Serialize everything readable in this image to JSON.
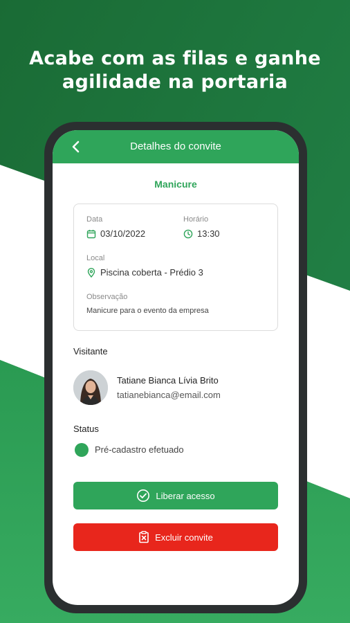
{
  "headline": {
    "line1": "Acabe com as filas e ganhe",
    "line2": "agilidade na portaria"
  },
  "appbar": {
    "title": "Detalhes do convite",
    "back_icon": "chevron-left-icon"
  },
  "invite": {
    "title": "Manicure",
    "date_label": "Data",
    "date_value": "03/10/2022",
    "time_label": "Horário",
    "time_value": "13:30",
    "location_label": "Local",
    "location_value": "Piscina coberta - Prédio 3",
    "note_label": "Observação",
    "note_value": "Manicure para o evento da empresa"
  },
  "visitor": {
    "section_label": "Visitante",
    "name": "Tatiane Bianca Lívia Brito",
    "email": "tatianebianca@email.com"
  },
  "status": {
    "section_label": "Status",
    "value": "Pré-cadastro efetuado",
    "color": "#2fa55a"
  },
  "actions": {
    "grant_label": "Liberar acesso",
    "grant_icon": "check-circle-icon",
    "delete_label": "Excluir convite",
    "delete_icon": "delete-doc-icon"
  },
  "colors": {
    "brand_green": "#2fa55a",
    "dark_green": "#1f7a3e",
    "danger_red": "#e8261c"
  }
}
